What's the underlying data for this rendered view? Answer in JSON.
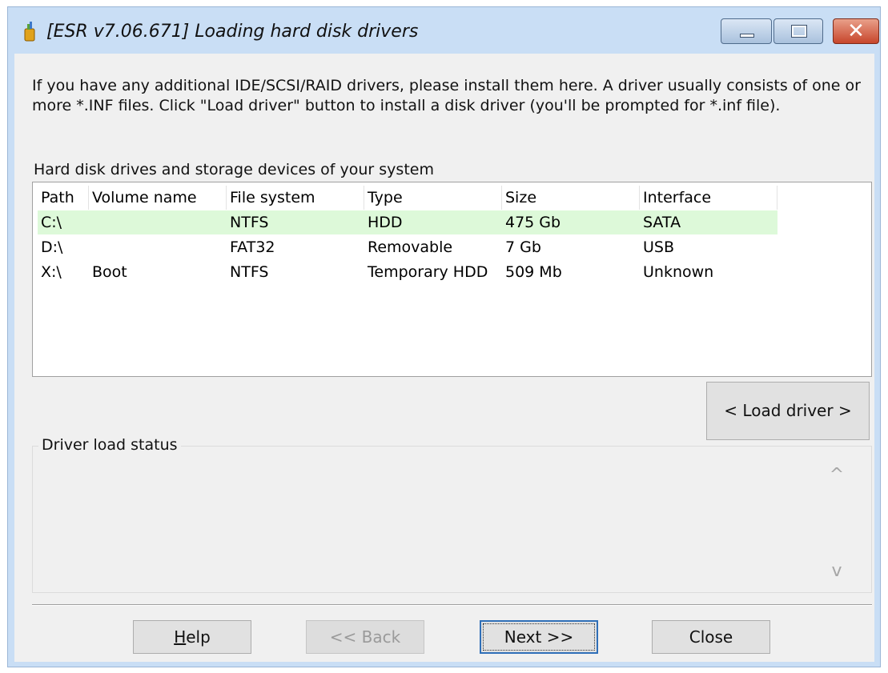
{
  "window": {
    "title": "[ESR v7.06.671]  Loading hard disk drivers",
    "close_glyph": "✕"
  },
  "intro": {
    "line1": "If you have any additional IDE/SCSI/RAID drivers, please install them here. A driver usually consists of one or",
    "line2": "more *.INF files. Click \"Load driver\" button to install a disk driver (you'll be prompted for *.inf file)."
  },
  "drives": {
    "caption": "Hard disk drives and storage devices of your system",
    "columns": [
      "Path",
      "Volume name",
      "File system",
      "Type",
      "Size",
      "Interface"
    ],
    "rows": [
      [
        "C:\\",
        "",
        "NTFS",
        "HDD",
        "475 Gb",
        "SATA"
      ],
      [
        "D:\\",
        "",
        "FAT32",
        "Removable",
        "7 Gb",
        "USB"
      ],
      [
        "X:\\",
        "Boot",
        "NTFS",
        "Temporary HDD",
        "509 Mb",
        "Unknown"
      ]
    ],
    "selected_color": "#ddf9d9"
  },
  "load_driver": {
    "label": "< Load driver >"
  },
  "status": {
    "label": "Driver load status",
    "scroll_up": "^",
    "scroll_down": "v"
  },
  "buttons": {
    "help_first": "H",
    "help_rest": "elp",
    "back": "<< Back",
    "next": "Next >>",
    "close": "Close"
  },
  "icons": {
    "app": "app-icon",
    "minimize": "minimize-icon",
    "maximize": "maximize-icon",
    "close": "close-icon"
  }
}
